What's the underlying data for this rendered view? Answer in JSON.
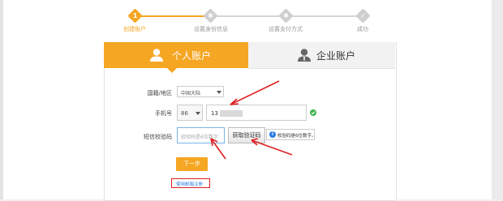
{
  "stepper": {
    "steps": [
      {
        "number": "1",
        "label": "创建账户"
      },
      {
        "number": "",
        "label": "设置身份信息"
      },
      {
        "number": "",
        "label": "设置支付方式"
      },
      {
        "number": "",
        "label": "成功"
      }
    ]
  },
  "tabs": {
    "personal": "个人账户",
    "enterprise": "企业账户"
  },
  "form": {
    "region_label": "国籍/地区",
    "region_value": "中国大陆",
    "phone_label": "手机号",
    "country_code": "86",
    "phone_value": "13",
    "sms_label": "短信校验码",
    "sms_placeholder": "校验码是6位数字",
    "get_code_button": "获取验证码",
    "hint_text": "校验码是6位数字。",
    "next_button": "下一步",
    "email_register_link": "使用邮箱注册"
  },
  "colors": {
    "accent": "#f5a623",
    "arrow": "#e02020",
    "ok": "#3ab54a",
    "highlight_box": "#e02020"
  }
}
